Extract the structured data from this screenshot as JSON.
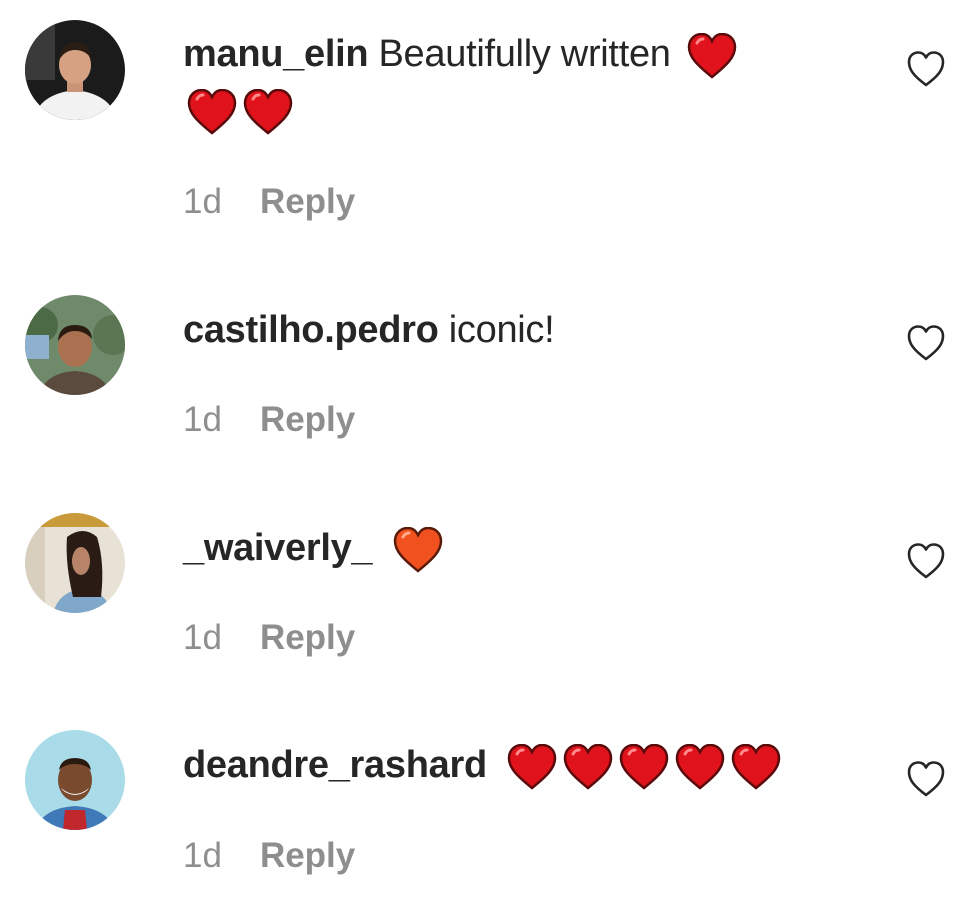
{
  "comments": [
    {
      "username": "manu_elin",
      "text": "Beautifully written",
      "emojis": [
        "red-heart",
        "red-heart",
        "red-heart"
      ],
      "time": "1d",
      "reply_label": "Reply",
      "avatar": "young man smiling, white shirt, dark background"
    },
    {
      "username": "castilho.pedro",
      "text": "iconic!",
      "emojis": [],
      "time": "1d",
      "reply_label": "Reply",
      "avatar": "young man outdoors, trees in background"
    },
    {
      "username": "_waiverly_",
      "text": "",
      "emojis": [
        "orange-heart"
      ],
      "time": "1d",
      "reply_label": "Reply",
      "avatar": "woman with long dark hair, light background"
    },
    {
      "username": "deandre_rashard",
      "text": "",
      "emojis": [
        "red-heart",
        "red-heart",
        "red-heart",
        "red-heart",
        "red-heart"
      ],
      "time": "1d",
      "reply_label": "Reply",
      "avatar": "smiling man, light blue background"
    }
  ],
  "colors": {
    "username": "#262626",
    "meta": "#8e8e8e",
    "red_heart": "#e0131c",
    "orange_heart": "#f0511f",
    "like_outline": "#262626"
  }
}
